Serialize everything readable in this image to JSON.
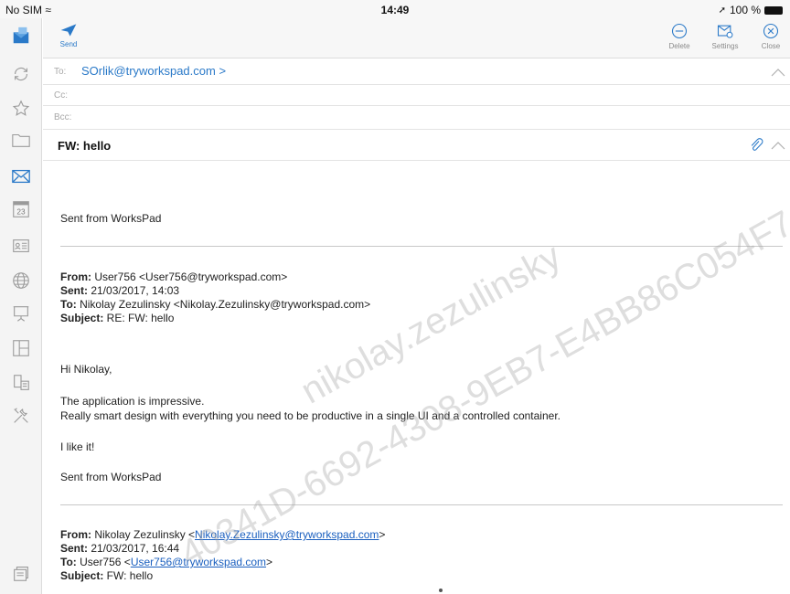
{
  "status": {
    "carrier": "No SIM",
    "time": "14:49",
    "battery": "100 %"
  },
  "toolbar": {
    "send_label": "Send",
    "delete_label": "Delete",
    "settings_label": "Settings",
    "close_label": "Close"
  },
  "compose": {
    "to_label": "To:",
    "to_value": "SOrlik@tryworkspad.com >",
    "cc_label": "Cc:",
    "bcc_label": "Bcc:",
    "subject": "FW: hello"
  },
  "body": {
    "sig1": "Sent from WorksPad",
    "quote1": {
      "from_label": "From:",
      "from_value": " User756 <User756@tryworkspad.com>",
      "sent_label": "Sent:",
      "sent_value": " 21/03/2017, 14:03",
      "to_label": "To:",
      "to_value": " Nikolay Zezulinsky <Nikolay.Zezulinsky@tryworkspad.com>",
      "subject_label": "Subject:",
      "subject_value": " RE: FW: hello"
    },
    "greeting": "Hi Nikolay,",
    "line1": "The application is impressive.",
    "line2": "Really smart design with everything you need to be productive in a single UI and a controlled container.",
    "line3": "I like it!",
    "sig2": "Sent from WorksPad",
    "quote2": {
      "from_label": "From:",
      "from_name": " Nikolay Zezulinsky <",
      "from_link": "Nikolay.Zezulinsky@tryworkspad.com",
      "from_close": ">",
      "sent_label": "Sent:",
      "sent_value": " 21/03/2017, 16:44",
      "to_label": "To:",
      "to_name": " User756 <",
      "to_link": "User756@tryworkspad.com",
      "to_close": ">",
      "subject_label": "Subject:",
      "subject_value": " FW: hello"
    }
  },
  "watermark": {
    "line1": "nikolay.zezulinsky",
    "line2": "40341D-6692-4308-9EB7-E4BB86C054F7"
  },
  "colors": {
    "accent": "#2a79c8",
    "link": "#1a5fbf"
  }
}
